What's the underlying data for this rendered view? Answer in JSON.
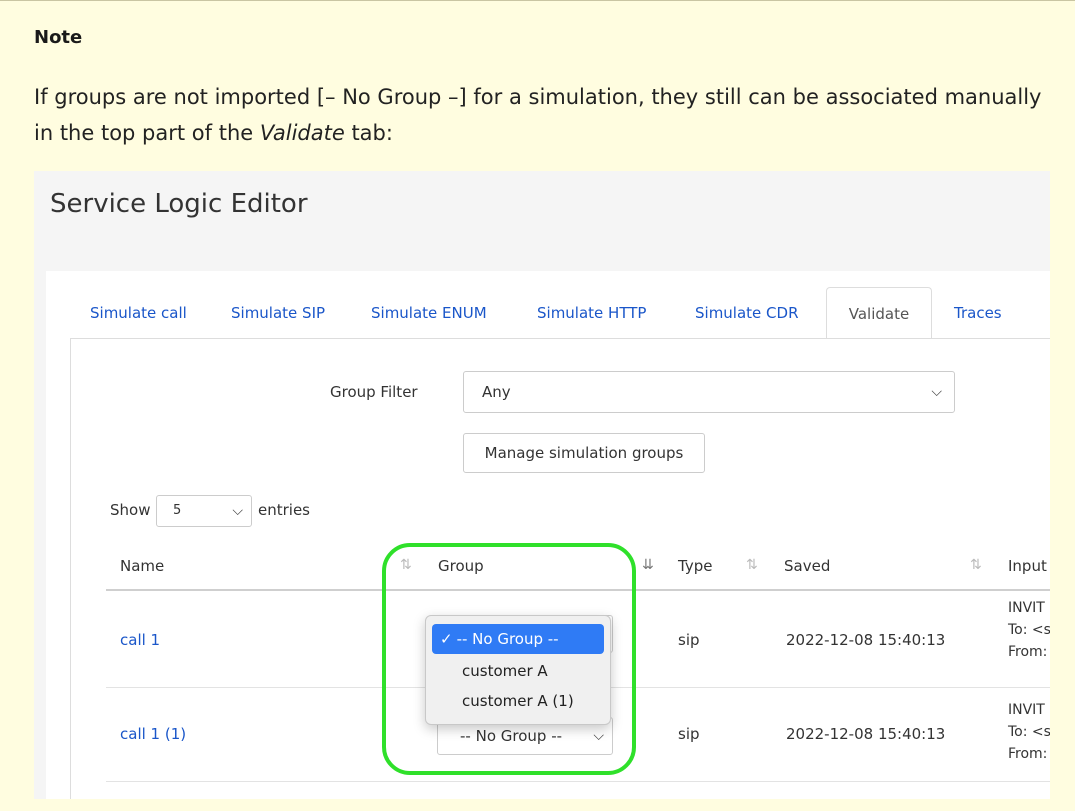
{
  "note": {
    "title": "Note",
    "text_before": "If groups are not imported [– No Group –] for a simulation, they still can be associated manually in the top part of the ",
    "text_em": "Validate",
    "text_after": " tab:"
  },
  "editor": {
    "title": "Service Logic Editor",
    "tabs": [
      {
        "label": "Simulate call"
      },
      {
        "label": "Simulate SIP"
      },
      {
        "label": "Simulate ENUM"
      },
      {
        "label": "Simulate HTTP"
      },
      {
        "label": "Simulate CDR"
      },
      {
        "label": "Validate"
      },
      {
        "label": "Traces"
      }
    ],
    "active_tab": "Validate",
    "group_filter": {
      "label": "Group Filter",
      "value": "Any"
    },
    "manage_button": "Manage simulation groups",
    "show_entries": {
      "show": "Show",
      "value": "5",
      "entries": "entries"
    },
    "table": {
      "columns": [
        "Name",
        "Group",
        "Type",
        "Saved",
        "Input"
      ],
      "rows": [
        {
          "name": "call 1",
          "group": "-- No Group --",
          "type": "sip",
          "saved": "2022-12-08 15:40:13",
          "input": [
            "INVIT",
            "To: <s",
            "From:"
          ]
        },
        {
          "name": "call 1 (1)",
          "group": "-- No Group --",
          "type": "sip",
          "saved": "2022-12-08 15:40:13",
          "input": [
            "INVIT",
            "To: <s",
            "From:"
          ]
        }
      ]
    },
    "group_dropdown": {
      "options": [
        "-- No Group --",
        "customer A",
        "customer A (1)"
      ],
      "selected": "-- No Group --"
    }
  },
  "colors": {
    "note_bg": "#fffde0",
    "link": "#1a56c9",
    "highlight": "#2fe02a",
    "selected_option": "#2f7bf5"
  },
  "icons": [
    "sort-icon",
    "sort-active-icon",
    "chevron-down-icon",
    "checkmark-icon"
  ]
}
